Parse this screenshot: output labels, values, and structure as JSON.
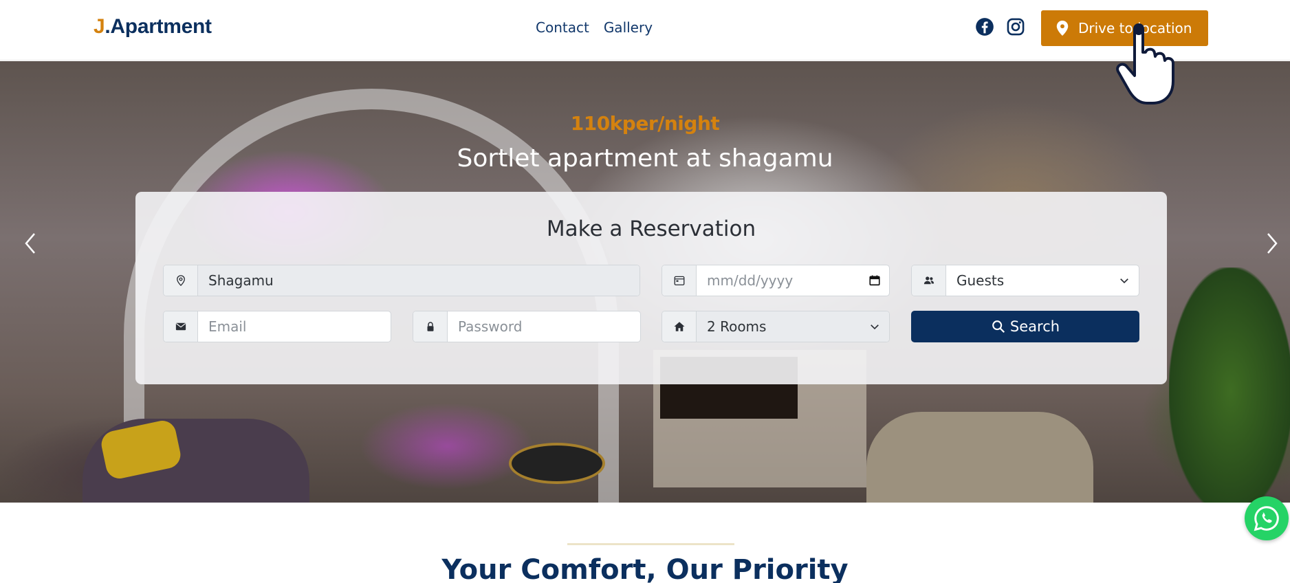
{
  "header": {
    "logo_initial": "J",
    "logo_rest": ".Apartment",
    "nav": [
      {
        "label": "Contact"
      },
      {
        "label": "Gallery"
      }
    ],
    "social": [
      {
        "icon": "facebook-icon"
      },
      {
        "icon": "instagram-icon"
      }
    ],
    "cta_label": "Drive to location"
  },
  "hero": {
    "price": "110kper/night",
    "title": "Sortlet apartment at shagamu"
  },
  "reservation": {
    "title": "Make a Reservation",
    "location_value": "Shagamu",
    "date_placeholder": "mm/dd/yyyy",
    "guests_value": "Guests",
    "email_placeholder": "Email",
    "password_placeholder": "Password",
    "rooms_value": "2 Rooms",
    "search_label": "Search"
  },
  "section": {
    "title": "Your Comfort, Our Priority"
  },
  "colors": {
    "brand_navy": "#0b2f5e",
    "brand_orange": "#cc7a07",
    "whatsapp_green": "#25d366"
  }
}
